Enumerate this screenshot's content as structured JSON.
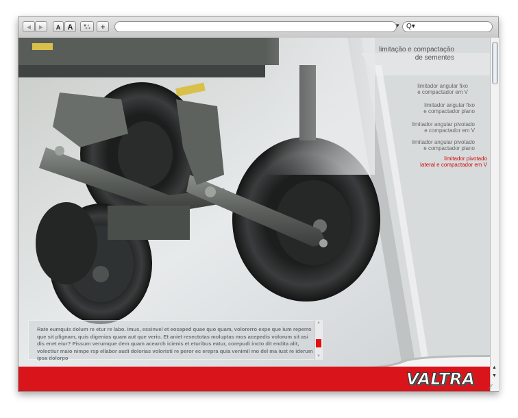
{
  "toolbar": {
    "back": "◀",
    "forward": "▶",
    "text_smaller": "A",
    "text_larger": "A",
    "add": "+",
    "search_icon": "Q▾"
  },
  "menu": {
    "title_line1": "limitação e compactação",
    "title_line2": "de sementes",
    "items": [
      {
        "line1": "limitador angular fixo",
        "line2": "e compactador em V",
        "active": false
      },
      {
        "line1": "limitador angular fixo",
        "line2": "e compactador plano",
        "active": false
      },
      {
        "line1": "limitador angular pivotado",
        "line2": "e compactador em V",
        "active": false
      },
      {
        "line1": "limitador angular pivotado",
        "line2": "e compactador plano",
        "active": false
      },
      {
        "line1": "limitador pivotado",
        "line2": "lateral e compactador em V",
        "active": true
      }
    ]
  },
  "body_text": "Rate eumquis dolum re etur re labo. Imus, essinvel et eosaped quae quo quam, volorerro expe que ium reperro que sit plignam, quis digenias quam aut que verio. Et aniet resectotas moluptas mos acepedis volorum sit asi dis enet eiur? Pissum verumque dem quam acearch icienis et eturibus eatur, corepudi incto dit endita alit, volectiur maio nimpe rsp ellabor audi dolorias voloristi re peror ec erepra quia venimil mo del ma iust re iderum ipsa dolorpo",
  "brand": {
    "logo_text": "VALTRA",
    "accent": "#d9141a"
  },
  "icons": [
    "back-arrow-icon",
    "forward-arrow-icon",
    "puzzle-icon",
    "plus-icon",
    "search-icon",
    "resize-grip-icon"
  ]
}
